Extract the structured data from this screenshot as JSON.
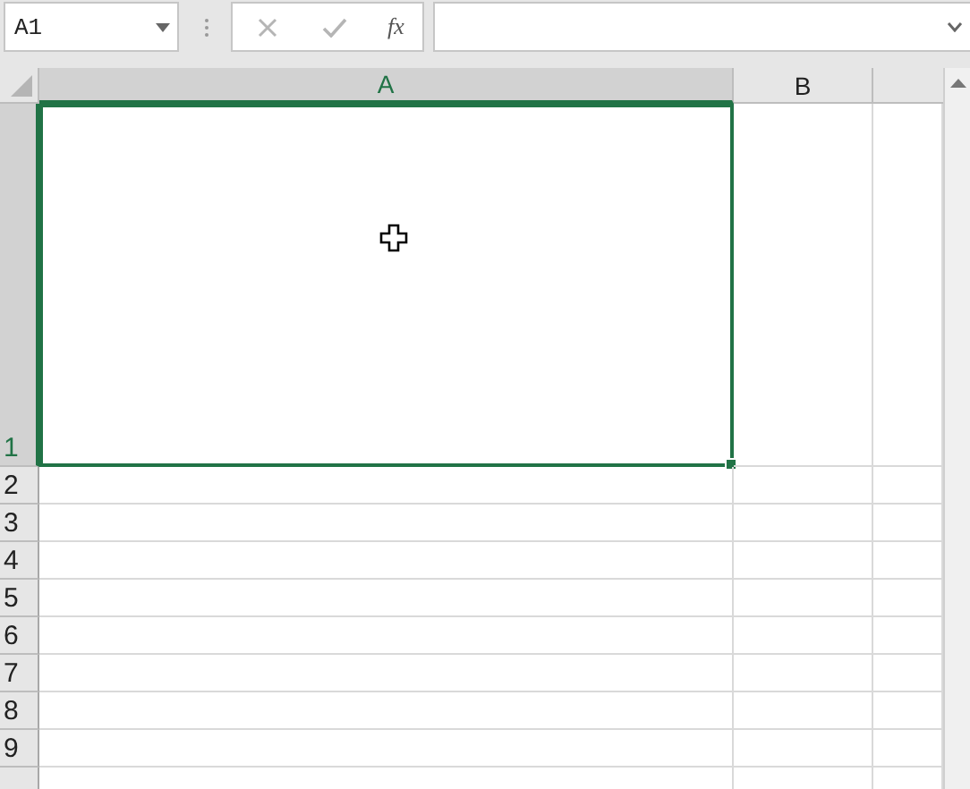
{
  "name_box": {
    "value": "A1"
  },
  "formula_bar": {
    "function_label": "fx"
  },
  "columns": [
    {
      "label": "A",
      "selected": true
    },
    {
      "label": "B",
      "selected": false
    }
  ],
  "rows": [
    {
      "label": "1",
      "selected": true
    },
    {
      "label": "2",
      "selected": false
    },
    {
      "label": "3",
      "selected": false
    },
    {
      "label": "4",
      "selected": false
    },
    {
      "label": "5",
      "selected": false
    },
    {
      "label": "6",
      "selected": false
    },
    {
      "label": "7",
      "selected": false
    },
    {
      "label": "8",
      "selected": false
    },
    {
      "label": "9",
      "selected": false
    }
  ]
}
